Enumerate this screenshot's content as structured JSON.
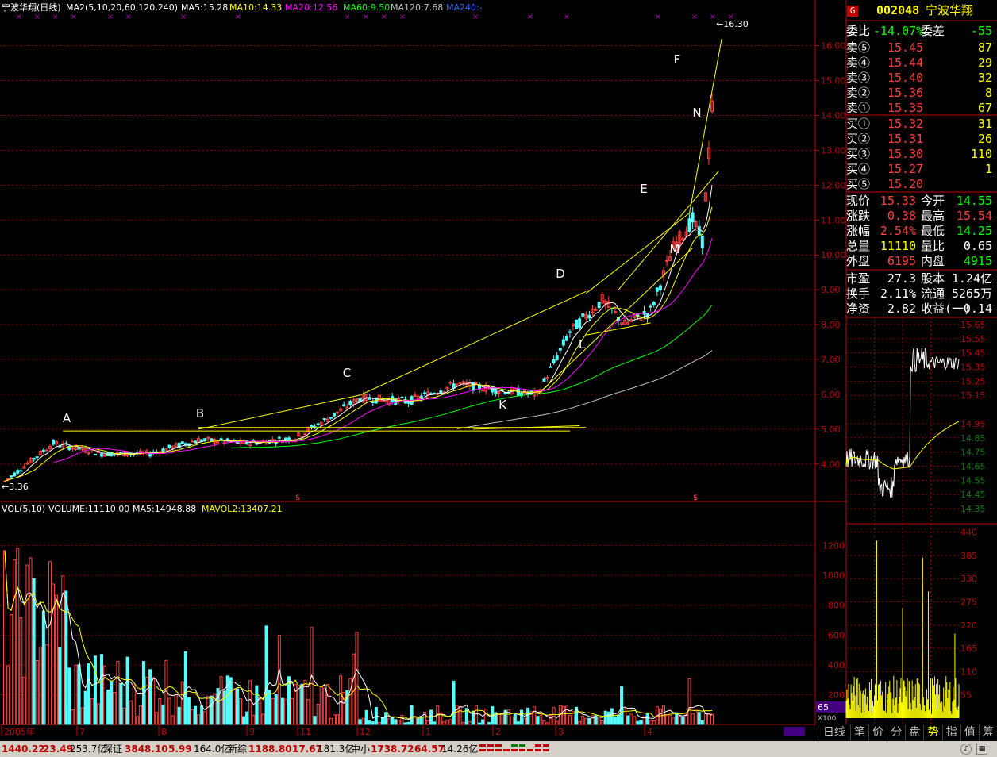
{
  "header": {
    "title": "宁波华翔(日线)",
    "ma_label": "MA2(5,10,20,60,120,240)",
    "ma_values": [
      {
        "label": "MA5:15.28",
        "color": "#ffffff"
      },
      {
        "label": "MA10:14.33",
        "color": "#ffff00"
      },
      {
        "label": "MA20:12.56",
        "color": "#ff00ff"
      },
      {
        "label": "MA60:9.50",
        "color": "#00ff00"
      },
      {
        "label": "MA120:7.68",
        "color": "#c0c0c0"
      },
      {
        "label": "MA240:-",
        "color": "#3060ff"
      }
    ]
  },
  "price_axis": {
    "labels": [
      "16.00",
      "15.00",
      "14.00",
      "13.00",
      "12.00",
      "11.00",
      "10.00",
      "9.00",
      "8.00",
      "7.00",
      "6.00",
      "5.00",
      "4.00"
    ],
    "min": 3.2,
    "max": 16.4
  },
  "price_markers": {
    "high": "16.30",
    "low": "3.36"
  },
  "annotations": [
    "A",
    "B",
    "C",
    "D",
    "E",
    "F",
    "K",
    "L",
    "M",
    "N"
  ],
  "volume_header": {
    "label": "VOL(5,10)",
    "volume": "VOLUME:11110.00",
    "ma5": "MA5:14948.88",
    "mavol2": "MAVOL2:13407.21"
  },
  "volume_axis": {
    "labels": [
      "1200",
      "1000",
      "800",
      "600",
      "400",
      "200"
    ],
    "unit": "X100",
    "current": "65"
  },
  "date_axis": [
    "2005年",
    "7",
    "8",
    "9",
    "11",
    "12",
    "1",
    "2",
    "3",
    "4"
  ],
  "quote": {
    "code": "002048",
    "name": "宁波华翔",
    "weibi_label": "委比",
    "weibi": "-14.07%",
    "weicha_label": "委差",
    "weicha": "-55",
    "sell": [
      {
        "label": "卖⑤",
        "price": "15.45",
        "vol": "87"
      },
      {
        "label": "卖④",
        "price": "15.44",
        "vol": "29"
      },
      {
        "label": "卖③",
        "price": "15.40",
        "vol": "32"
      },
      {
        "label": "卖②",
        "price": "15.36",
        "vol": "8"
      },
      {
        "label": "卖①",
        "price": "15.35",
        "vol": "67"
      }
    ],
    "buy": [
      {
        "label": "买①",
        "price": "15.32",
        "vol": "31"
      },
      {
        "label": "买②",
        "price": "15.31",
        "vol": "26"
      },
      {
        "label": "买③",
        "price": "15.30",
        "vol": "110"
      },
      {
        "label": "买④",
        "price": "15.27",
        "vol": "1"
      },
      {
        "label": "买⑤",
        "price": "15.20",
        "vol": ""
      }
    ],
    "stats": [
      {
        "l1": "现价",
        "v1": "15.33",
        "c1": "#ff4040",
        "l2": "今开",
        "v2": "14.55",
        "c2": "#00ff00"
      },
      {
        "l1": "涨跌",
        "v1": "0.38",
        "c1": "#ff4040",
        "l2": "最高",
        "v2": "15.54",
        "c2": "#ff4040"
      },
      {
        "l1": "涨幅",
        "v1": "2.54%",
        "c1": "#ff4040",
        "l2": "最低",
        "v2": "14.25",
        "c2": "#00ff00"
      },
      {
        "l1": "总量",
        "v1": "11110",
        "c1": "#ffff00",
        "l2": "量比",
        "v2": "0.65",
        "c2": "#ffffff"
      },
      {
        "l1": "外盘",
        "v1": "6195",
        "c1": "#ff4040",
        "l2": "内盘",
        "v2": "4915",
        "c2": "#00ff00"
      }
    ],
    "finance": [
      {
        "l1": "市盈",
        "v1": "27.3",
        "l2": "股本",
        "v2": "1.24亿"
      },
      {
        "l1": "换手",
        "v1": "2.11%",
        "l2": "流通",
        "v2": "5265万"
      },
      {
        "l1": "净资",
        "v1": "2.82",
        "l2": "收益(一)",
        "v2": "0.14"
      }
    ]
  },
  "intraday_axis": [
    "15.65",
    "15.55",
    "15.45",
    "15.35",
    "15.25",
    "15.15",
    "14.95",
    "14.85",
    "14.75",
    "14.65",
    "14.55",
    "14.45",
    "14.35"
  ],
  "intraday_vol_axis": [
    "440",
    "385",
    "330",
    "275",
    "220",
    "165",
    "110",
    "55"
  ],
  "tabs": [
    "日线",
    "笔",
    "价",
    "分",
    "盘",
    "势",
    "指",
    "值",
    "筹"
  ],
  "active_tab": "势",
  "status": {
    "sh_index": "1440.22",
    "sh_change": "23.49",
    "sh_amount": "253.7亿",
    "sz_label": "深证",
    "sz_index": "3848.10",
    "sz_change": "5.99",
    "sz_amount": "164.0亿",
    "xl_label": "新综",
    "xl_index": "1188.80",
    "xl_change": "17.67",
    "xl_amount": "181.3亿",
    "zx_label": "中小",
    "zx_index": "1738.72",
    "zx_change": "64.57",
    "zx_amount": "14.26亿"
  },
  "colors": {
    "up": "#ff4040",
    "down": "#54ffff",
    "grid": "#800000",
    "yellow": "#ffff00"
  }
}
